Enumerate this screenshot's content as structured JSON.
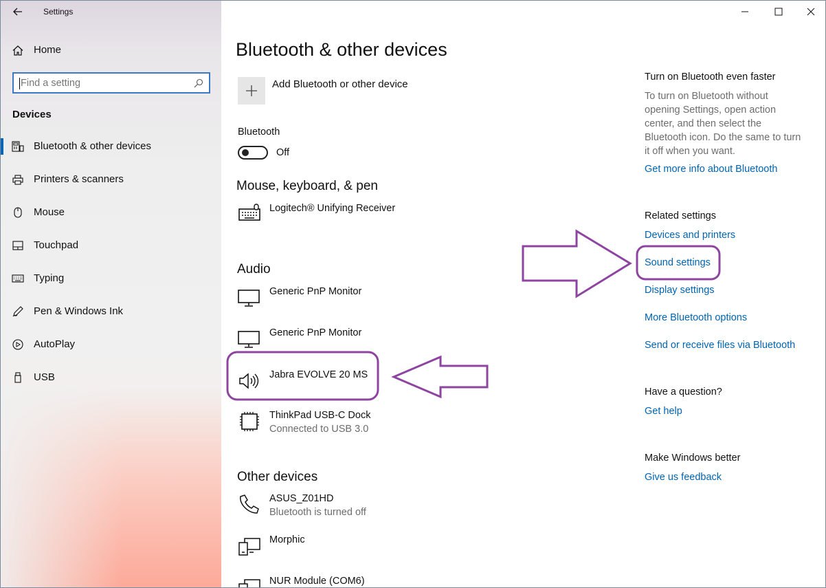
{
  "window": {
    "title": "Settings"
  },
  "sidebar": {
    "home_label": "Home",
    "search_placeholder": "Find a setting",
    "section_label": "Devices",
    "items": [
      {
        "label": "Bluetooth & other devices",
        "icon": "bluetooth-devices-icon",
        "active": true
      },
      {
        "label": "Printers & scanners",
        "icon": "printer-icon"
      },
      {
        "label": "Mouse",
        "icon": "mouse-icon"
      },
      {
        "label": "Touchpad",
        "icon": "touchpad-icon"
      },
      {
        "label": "Typing",
        "icon": "keyboard-icon"
      },
      {
        "label": "Pen & Windows Ink",
        "icon": "pen-icon"
      },
      {
        "label": "AutoPlay",
        "icon": "autoplay-icon"
      },
      {
        "label": "USB",
        "icon": "usb-icon"
      }
    ]
  },
  "main": {
    "title": "Bluetooth & other devices",
    "add_device_label": "Add Bluetooth or other device",
    "bluetooth_label": "Bluetooth",
    "bluetooth_state": "Off",
    "sections": {
      "mouse_keyboard_pen": {
        "heading": "Mouse, keyboard, & pen",
        "devices": [
          {
            "name": "Logitech® Unifying Receiver",
            "icon": "keyboard-icon"
          }
        ]
      },
      "audio": {
        "heading": "Audio",
        "devices": [
          {
            "name": "Generic PnP Monitor",
            "icon": "monitor-icon"
          },
          {
            "name": "Generic PnP Monitor",
            "icon": "monitor-icon"
          },
          {
            "name": "Jabra EVOLVE 20 MS",
            "icon": "speaker-icon"
          },
          {
            "name": "ThinkPad USB-C Dock",
            "status": "Connected to USB 3.0",
            "icon": "chip-icon"
          }
        ]
      },
      "other_devices": {
        "heading": "Other devices",
        "devices": [
          {
            "name": "ASUS_Z01HD",
            "status": "Bluetooth is turned off",
            "icon": "phone-icon"
          },
          {
            "name": "Morphic",
            "icon": "device-icon"
          },
          {
            "name": "NUR Module (COM6)",
            "icon": "device-icon"
          }
        ]
      }
    }
  },
  "right_panel": {
    "tip_heading": "Turn on Bluetooth even faster",
    "tip_lines": [
      "To turn on Bluetooth without",
      "opening Settings, open action",
      "center, and then select the",
      "Bluetooth icon. Do the same to turn",
      "it off when you want."
    ],
    "tip_link": "Get more info about Bluetooth",
    "related_heading": "Related settings",
    "related_links": [
      "Devices and printers",
      "Sound settings",
      "Display settings",
      "More Bluetooth options",
      "Send or receive files via Bluetooth"
    ],
    "question_heading": "Have a question?",
    "question_link": "Get help",
    "feedback_heading": "Make Windows better",
    "feedback_link": "Give us feedback"
  },
  "annotation_color": "#8e44a0"
}
